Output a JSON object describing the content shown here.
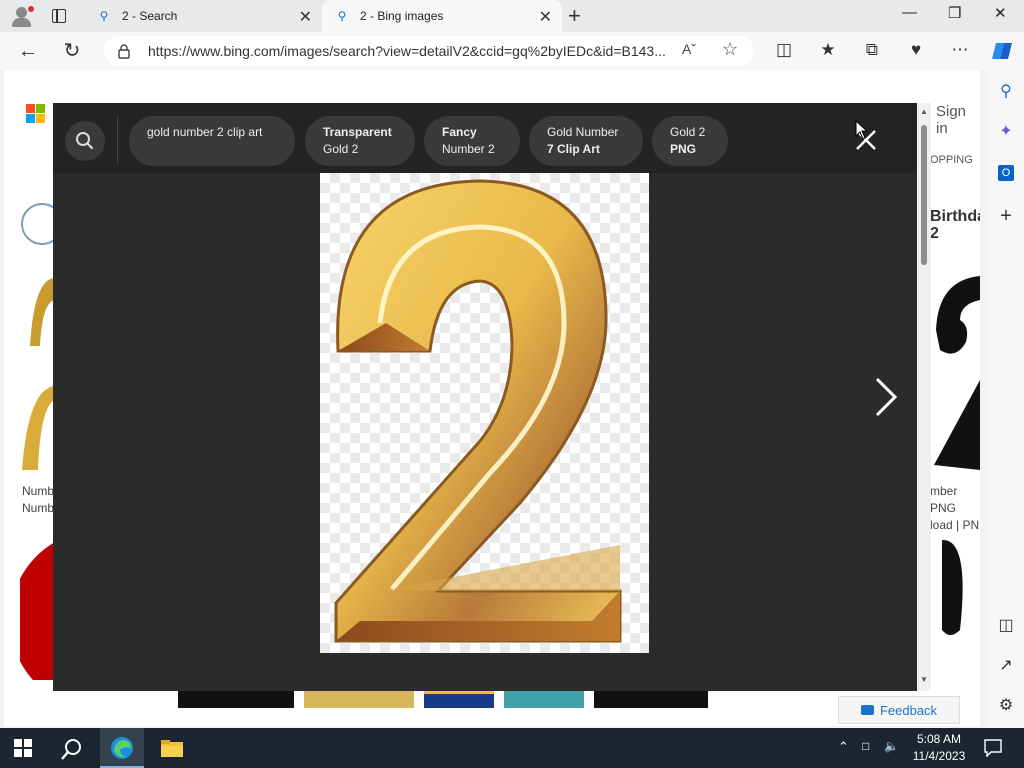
{
  "browser": {
    "tabs": [
      {
        "title": "2 - Search",
        "icon": "search-icon"
      },
      {
        "title": "2 - Bing images",
        "icon": "search-icon",
        "active": true
      }
    ],
    "url": "https://www.bing.com/images/search?view=detailV2&ccid=gq%2byIEDc&id=B143...",
    "read_aloud_label": "A",
    "colors": {
      "accent": "#1a6fd1",
      "tab_bg": "#e9e9e9",
      "toolbar_bg": "#f7f7f7"
    }
  },
  "page": {
    "sign_in": "Sign in",
    "shopping": "OPPING",
    "birthday_line1": "Birthda",
    "birthday_line2": "2",
    "left_caption_1": "Numb",
    "left_caption_2": "Numb",
    "right_caption_1": "mber PNG",
    "right_caption_2": "load | PN",
    "feedback": "Feedback"
  },
  "modal": {
    "search_chips": [
      {
        "line1": "gold number 2 clip art",
        "line2": ""
      },
      {
        "line1": "Transparent",
        "line2": "Gold 2"
      },
      {
        "line1": "Fancy",
        "line2": "Number 2"
      },
      {
        "line1": "Gold Number",
        "line2": "7 Clip Art"
      },
      {
        "line1": "Gold 2",
        "line2": "PNG"
      }
    ],
    "image_subject": "gold number 2",
    "colors": {
      "backdrop": "#2b2b2b",
      "header": "#242424",
      "chip": "#3a3a3a"
    }
  },
  "taskbar": {
    "time": "5:08 AM",
    "date": "11/4/2023"
  }
}
